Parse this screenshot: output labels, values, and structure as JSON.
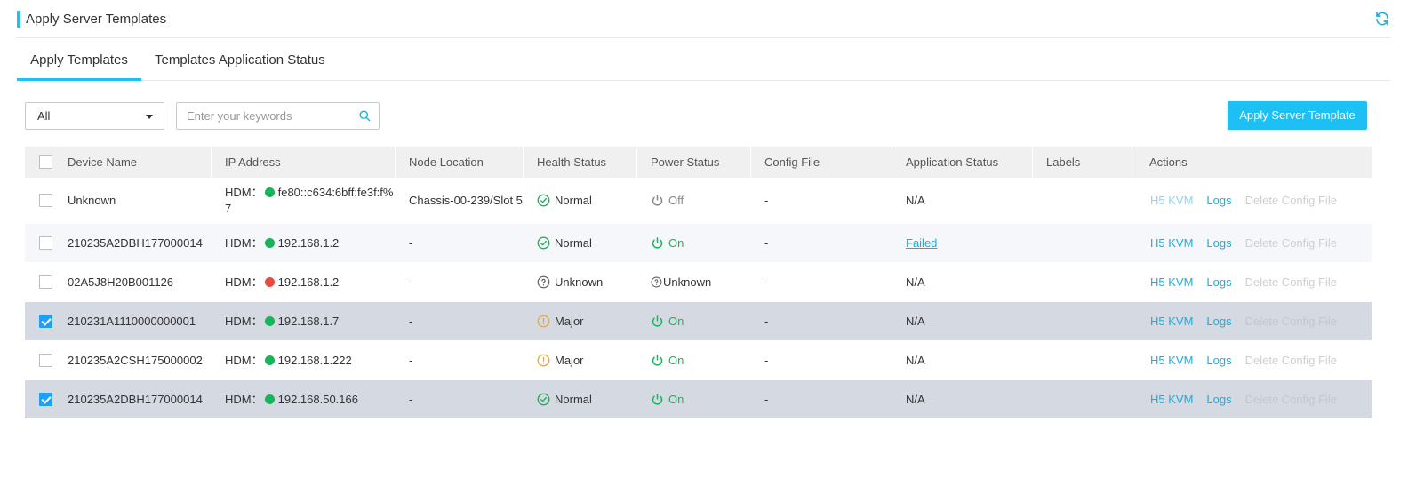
{
  "header": {
    "title": "Apply Server Templates",
    "refresh_icon": "refresh-icon",
    "accent": "#20c0f5"
  },
  "tabs": [
    {
      "label": "Apply Templates",
      "active": true
    },
    {
      "label": "Templates Application Status",
      "active": false
    }
  ],
  "filter": {
    "selected": "All"
  },
  "search": {
    "placeholder": "Enter your keywords",
    "value": ""
  },
  "apply_button": {
    "label": "Apply Server Template",
    "color": "#1dc0f5"
  },
  "table": {
    "columns": [
      "Device Name",
      "IP Address",
      "Node Location",
      "Health Status",
      "Power Status",
      "Config File",
      "Application Status",
      "Labels",
      "Actions"
    ],
    "rows": [
      {
        "checked": false,
        "device": "Unknown",
        "ip_prefix": "HDM：",
        "ip_dot": "green",
        "ip_line1": "fe80::c634:6bff:fe3f:f%",
        "ip_line2": "7",
        "node": "Chassis-00-239/Slot 5",
        "health": "Normal",
        "health_icon": "check-circle-icon",
        "power": "Off",
        "power_icon": "power-icon",
        "config": "-",
        "app_status": "N/A",
        "labels": "",
        "actions": [
          "H5 KVM",
          "Logs",
          "Delete Config File"
        ],
        "actions_state": [
          "soft",
          "enabled",
          "disabled"
        ]
      },
      {
        "checked": false,
        "device": "210235A2DBH177000014",
        "ip_prefix": "HDM：",
        "ip_dot": "green",
        "ip_line1": "192.168.1.2",
        "ip_line2": "",
        "node": "-",
        "health": "Normal",
        "health_icon": "check-circle-icon",
        "power": "On",
        "power_icon": "power-icon",
        "config": "-",
        "app_status": "Failed",
        "app_status_link": true,
        "labels": "",
        "actions": [
          "H5 KVM",
          "Logs",
          "Delete Config File"
        ],
        "actions_state": [
          "enabled",
          "enabled",
          "disabled"
        ]
      },
      {
        "checked": false,
        "device": "02A5J8H20B001126",
        "ip_prefix": "HDM：",
        "ip_dot": "red",
        "ip_line1": "192.168.1.2",
        "ip_line2": "",
        "node": "-",
        "health": "Unknown",
        "health_icon": "question-circle-icon",
        "power": "Unknown",
        "power_icon": "question-circle-icon",
        "config": "-",
        "app_status": "N/A",
        "labels": "",
        "actions": [
          "H5 KVM",
          "Logs",
          "Delete Config File"
        ],
        "actions_state": [
          "enabled",
          "enabled",
          "disabled"
        ]
      },
      {
        "checked": true,
        "device": "210231A1110000000001",
        "ip_prefix": "HDM：",
        "ip_dot": "green",
        "ip_line1": "192.168.1.7",
        "ip_line2": "",
        "node": "-",
        "health": "Major",
        "health_icon": "warning-circle-icon",
        "power": "On",
        "power_icon": "power-icon",
        "config": "-",
        "app_status": "N/A",
        "labels": "",
        "actions": [
          "H5 KVM",
          "Logs",
          "Delete Config File"
        ],
        "actions_state": [
          "enabled",
          "enabled",
          "disabled"
        ]
      },
      {
        "checked": false,
        "device": "210235A2CSH175000002",
        "ip_prefix": "HDM：",
        "ip_dot": "green",
        "ip_line1": "192.168.1.222",
        "ip_line2": "",
        "node": "-",
        "health": "Major",
        "health_icon": "warning-circle-icon",
        "power": "On",
        "power_icon": "power-icon",
        "config": "-",
        "app_status": "N/A",
        "labels": "",
        "actions": [
          "H5 KVM",
          "Logs",
          "Delete Config File"
        ],
        "actions_state": [
          "enabled",
          "enabled",
          "disabled"
        ]
      },
      {
        "checked": true,
        "device": "210235A2DBH177000014",
        "ip_prefix": "HDM：",
        "ip_dot": "green",
        "ip_line1": "192.168.50.166",
        "ip_line2": "",
        "node": "-",
        "health": "Normal",
        "health_icon": "check-circle-icon",
        "power": "On",
        "power_icon": "power-icon",
        "config": "-",
        "app_status": "N/A",
        "labels": "",
        "actions": [
          "H5 KVM",
          "Logs",
          "Delete Config File"
        ],
        "actions_state": [
          "enabled",
          "enabled",
          "disabled"
        ]
      }
    ]
  },
  "colors": {
    "normal": "#19b35c",
    "major": "#f5a623",
    "unknown": "#666666",
    "power_on": "#19b35c",
    "power_off": "#888888",
    "link": "#1aaee0",
    "selected_row": "#d5d9e1"
  }
}
